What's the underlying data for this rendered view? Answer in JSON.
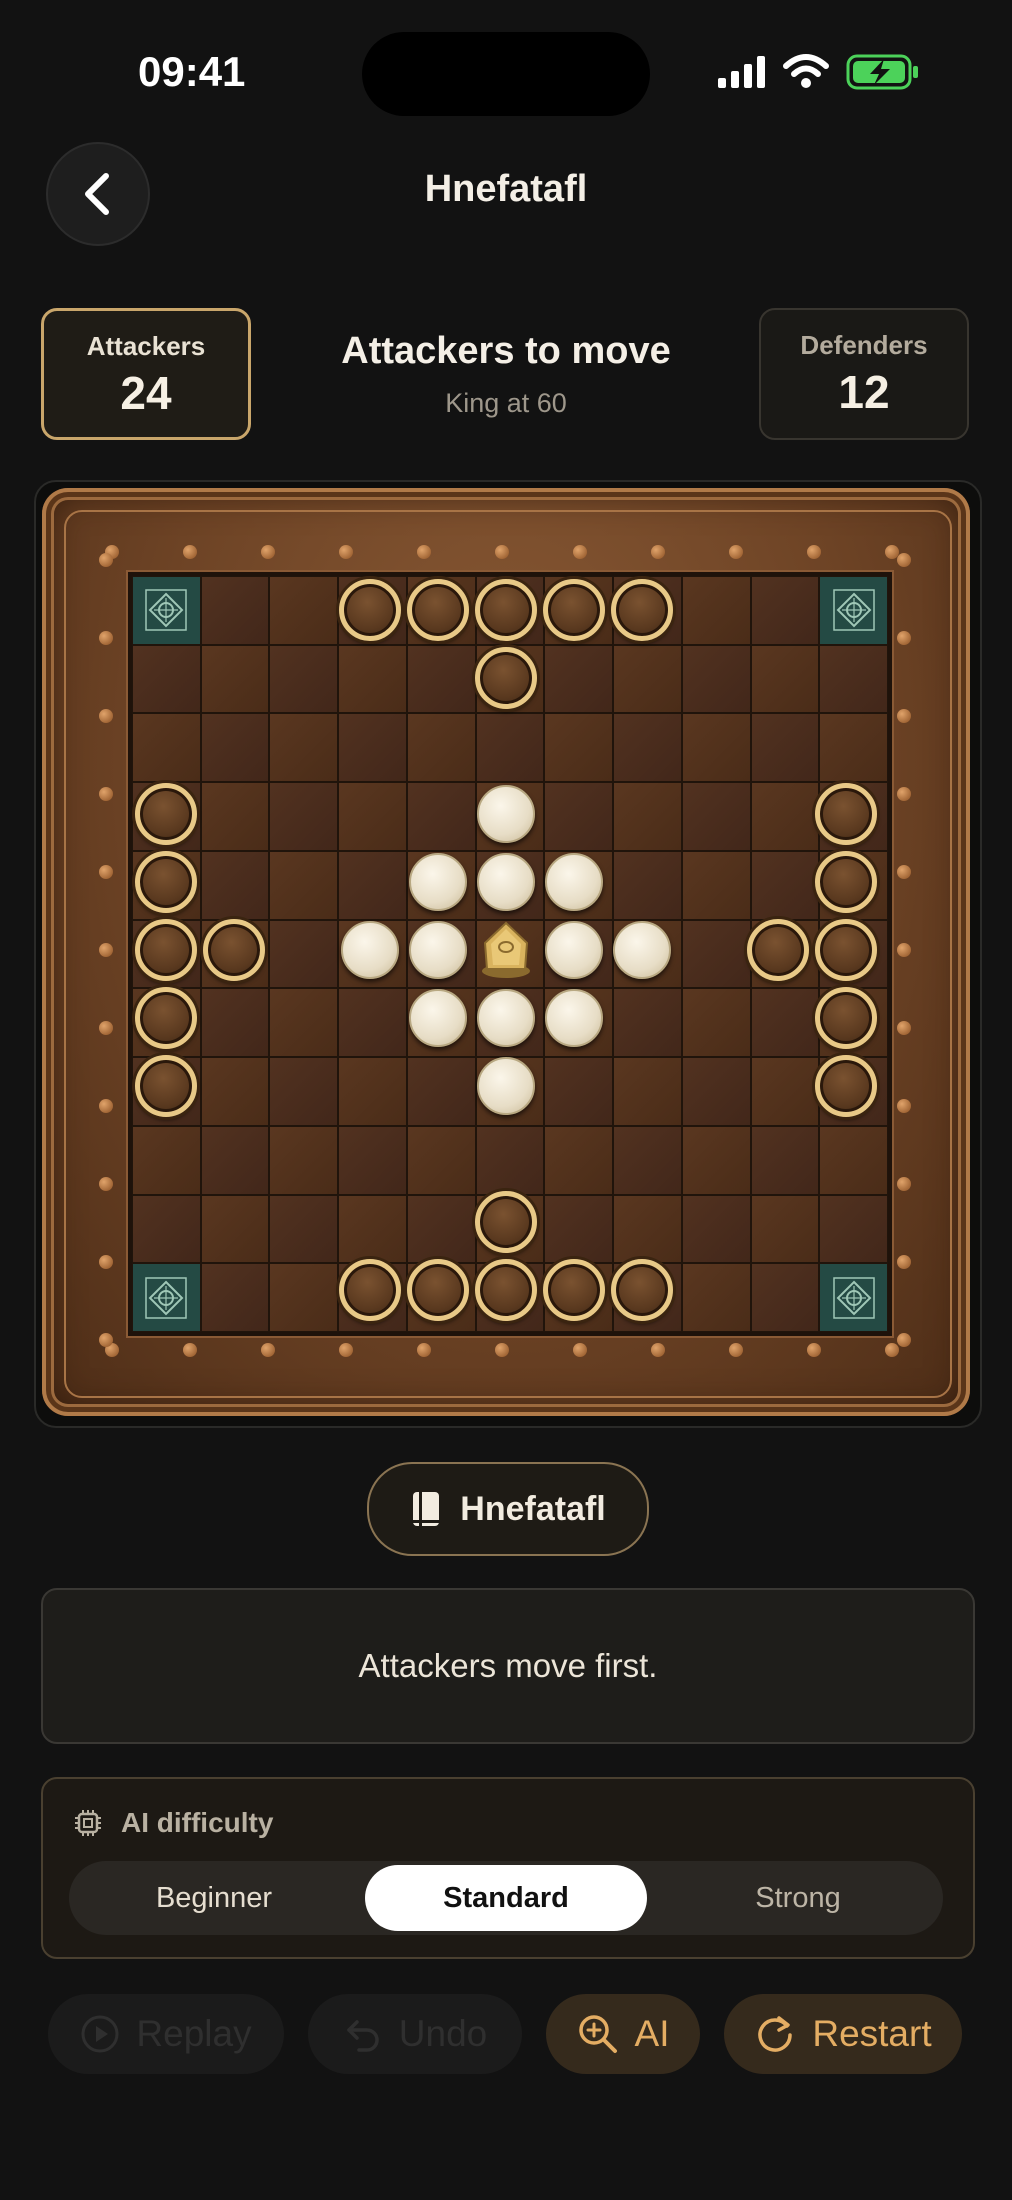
{
  "status_bar": {
    "time": "09:41"
  },
  "header": {
    "title": "Hnefatafl"
  },
  "scores": {
    "attackers": {
      "label": "Attackers",
      "value": "24"
    },
    "defenders": {
      "label": "Defenders",
      "value": "12"
    }
  },
  "turn": {
    "title": "Attackers to move",
    "subtitle": "King at 60"
  },
  "board": {
    "size": 11,
    "corners": [
      [
        0,
        0
      ],
      [
        0,
        10
      ],
      [
        10,
        0
      ],
      [
        10,
        10
      ]
    ],
    "attackers": [
      [
        0,
        3
      ],
      [
        0,
        4
      ],
      [
        0,
        5
      ],
      [
        0,
        6
      ],
      [
        0,
        7
      ],
      [
        1,
        5
      ],
      [
        3,
        0
      ],
      [
        4,
        0
      ],
      [
        5,
        0
      ],
      [
        5,
        1
      ],
      [
        6,
        0
      ],
      [
        7,
        0
      ],
      [
        3,
        10
      ],
      [
        4,
        10
      ],
      [
        5,
        10
      ],
      [
        5,
        9
      ],
      [
        6,
        10
      ],
      [
        7,
        10
      ],
      [
        9,
        5
      ],
      [
        10,
        3
      ],
      [
        10,
        4
      ],
      [
        10,
        5
      ],
      [
        10,
        6
      ],
      [
        10,
        7
      ]
    ],
    "defenders": [
      [
        3,
        5
      ],
      [
        4,
        4
      ],
      [
        4,
        5
      ],
      [
        4,
        6
      ],
      [
        5,
        3
      ],
      [
        5,
        4
      ],
      [
        5,
        6
      ],
      [
        5,
        7
      ],
      [
        6,
        4
      ],
      [
        6,
        5
      ],
      [
        6,
        6
      ],
      [
        7,
        5
      ]
    ],
    "king": [
      5,
      5
    ]
  },
  "variant": {
    "label": "Hnefatafl",
    "icon": "book-icon"
  },
  "message": "Attackers move first.",
  "ai": {
    "title": "AI difficulty",
    "options": [
      "Beginner",
      "Standard",
      "Strong"
    ],
    "selected": "Standard"
  },
  "actions": {
    "replay": "Replay",
    "undo": "Undo",
    "ai_hint": "AI",
    "restart": "Restart"
  },
  "colors": {
    "accent": "#e4ad63",
    "attacker_ring": "#e8c987",
    "corner": "#244a44"
  }
}
